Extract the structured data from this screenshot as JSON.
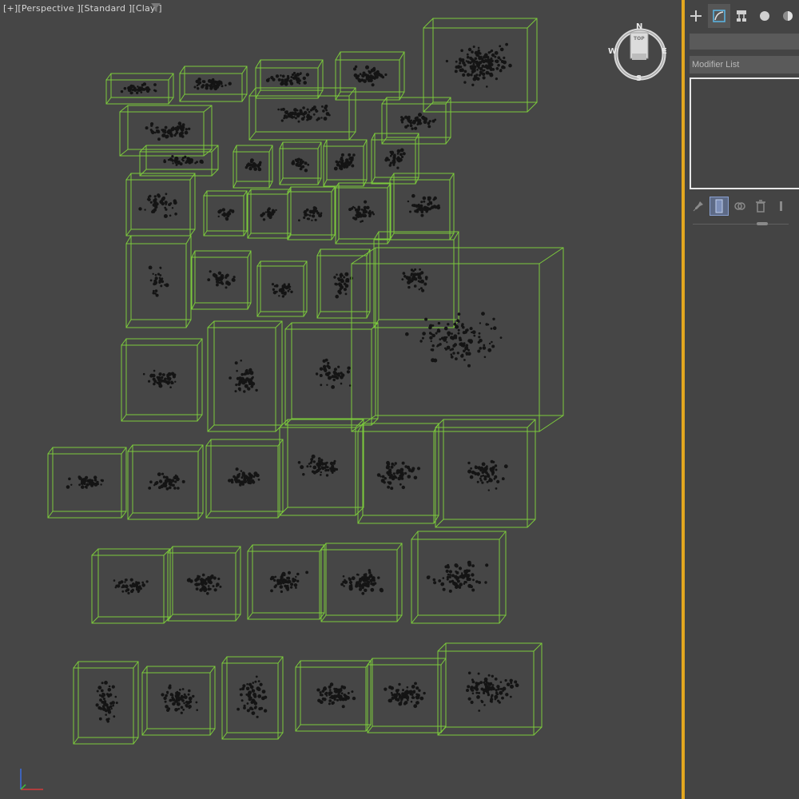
{
  "viewport": {
    "labels": [
      "[+]",
      "[Perspective ]",
      "[Standard ]",
      "[Clay ]"
    ],
    "filter_icon": "funnel-icon",
    "background": "#464646",
    "wire_color": "#7ccb3c",
    "point_color": "#141414"
  },
  "viewcube": {
    "north": "N",
    "south": "S",
    "east": "E",
    "west": "W",
    "face_label": "TOP"
  },
  "command_panel": {
    "tabs": [
      {
        "icon": "create-plus-icon",
        "label": "Create",
        "active": false
      },
      {
        "icon": "modify-bend-icon",
        "label": "Modify",
        "active": true
      },
      {
        "icon": "hierarchy-icon",
        "label": "Hierarchy",
        "active": false
      },
      {
        "icon": "motion-icon",
        "label": "Motion",
        "active": false
      },
      {
        "icon": "display-icon",
        "label": "Display",
        "active": false
      }
    ],
    "object_name": "",
    "modifier_list": "Modifier List",
    "accent": "#e3a71f"
  }
}
